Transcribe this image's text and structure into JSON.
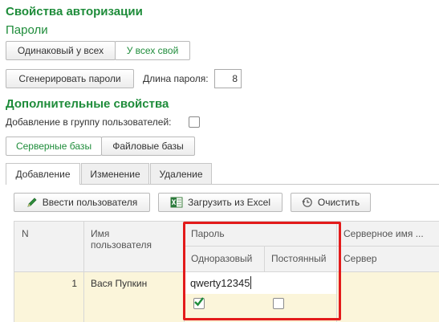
{
  "auth": {
    "title": "Свойства авторизации",
    "passwords_title": "Пароли"
  },
  "password_mode": {
    "same": "Одинаковый у всех",
    "own": "У всех свой"
  },
  "generate": {
    "button": "Сгенерировать пароли",
    "length_label": "Длина пароля:",
    "length_value": "8"
  },
  "additional": {
    "title": "Дополнительные свойства",
    "add_to_group_label": "Добавление в группу пользователей:"
  },
  "bases": {
    "server": "Серверные базы",
    "file": "Файловые базы"
  },
  "tabs": [
    "Добавление",
    "Изменение",
    "Удаление"
  ],
  "toolbar": {
    "add_user": "Ввести пользователя",
    "load_excel": "Загрузить из Excel",
    "clear": "Очистить"
  },
  "table": {
    "col_n": "N",
    "col_name": "Имя\nпользователя",
    "col_password": "Пароль",
    "col_onetime": "Одноразовый",
    "col_permanent": "Постоянный",
    "col_server_name": "Серверное имя ...",
    "col_server": "Сервер",
    "rows": [
      {
        "n": "1",
        "name": "Вася Пупкин",
        "password": "qwerty12345",
        "onetime": true,
        "permanent": false
      }
    ]
  },
  "colors": {
    "accent": "#1e8c3a",
    "highlight": "#e31b1b",
    "row_bg": "#fbf5da"
  }
}
